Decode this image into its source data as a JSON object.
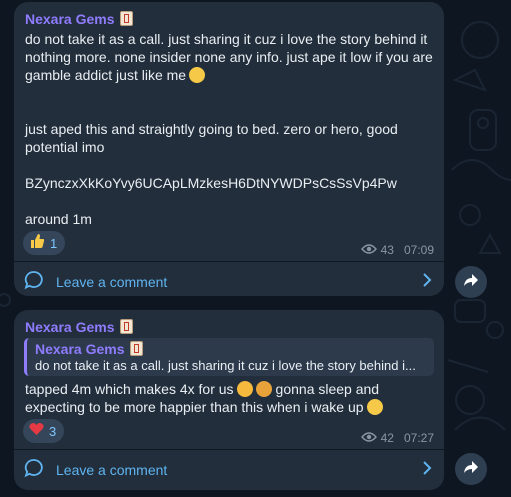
{
  "channel": {
    "name": "Nexara Gems"
  },
  "posts": [
    {
      "sender": "Nexara Gems",
      "paragraph1": "do not take it as a call. just sharing it cuz i love the story behind it nothing more. none insider none any info. just ape it low if you are gamble addict just like me",
      "paragraph2": "just aped this and straightly going to bed. zero or hero, good potential imo",
      "contract": "BZynczxXkKoYvy6UCApLMzkesH6DtNYWDPsCsSsVp4Pw",
      "paragraph3": "around 1m",
      "reaction": {
        "icon": "thumbs-up-icon",
        "count": "1"
      },
      "views": "43",
      "time": "07:09",
      "comment_label": "Leave a comment"
    },
    {
      "sender": "Nexara Gems",
      "reply": {
        "name": "Nexara Gems",
        "text": "do not take it as a call. just sharing it cuz i love the story behind i..."
      },
      "text_part1": "tapped 4m which makes 4x for us",
      "text_part2": "gonna sleep and expecting to be more happier than this when i wake up",
      "reaction": {
        "icon": "heart-icon",
        "count": "3"
      },
      "views": "42",
      "time": "07:27",
      "comment_label": "Leave a comment"
    }
  ],
  "colors": {
    "background": "#0e1621",
    "bubble": "#222e3b",
    "sender": "#8f7cff",
    "link": "#5fb4f0",
    "meta": "#8a96a3"
  }
}
